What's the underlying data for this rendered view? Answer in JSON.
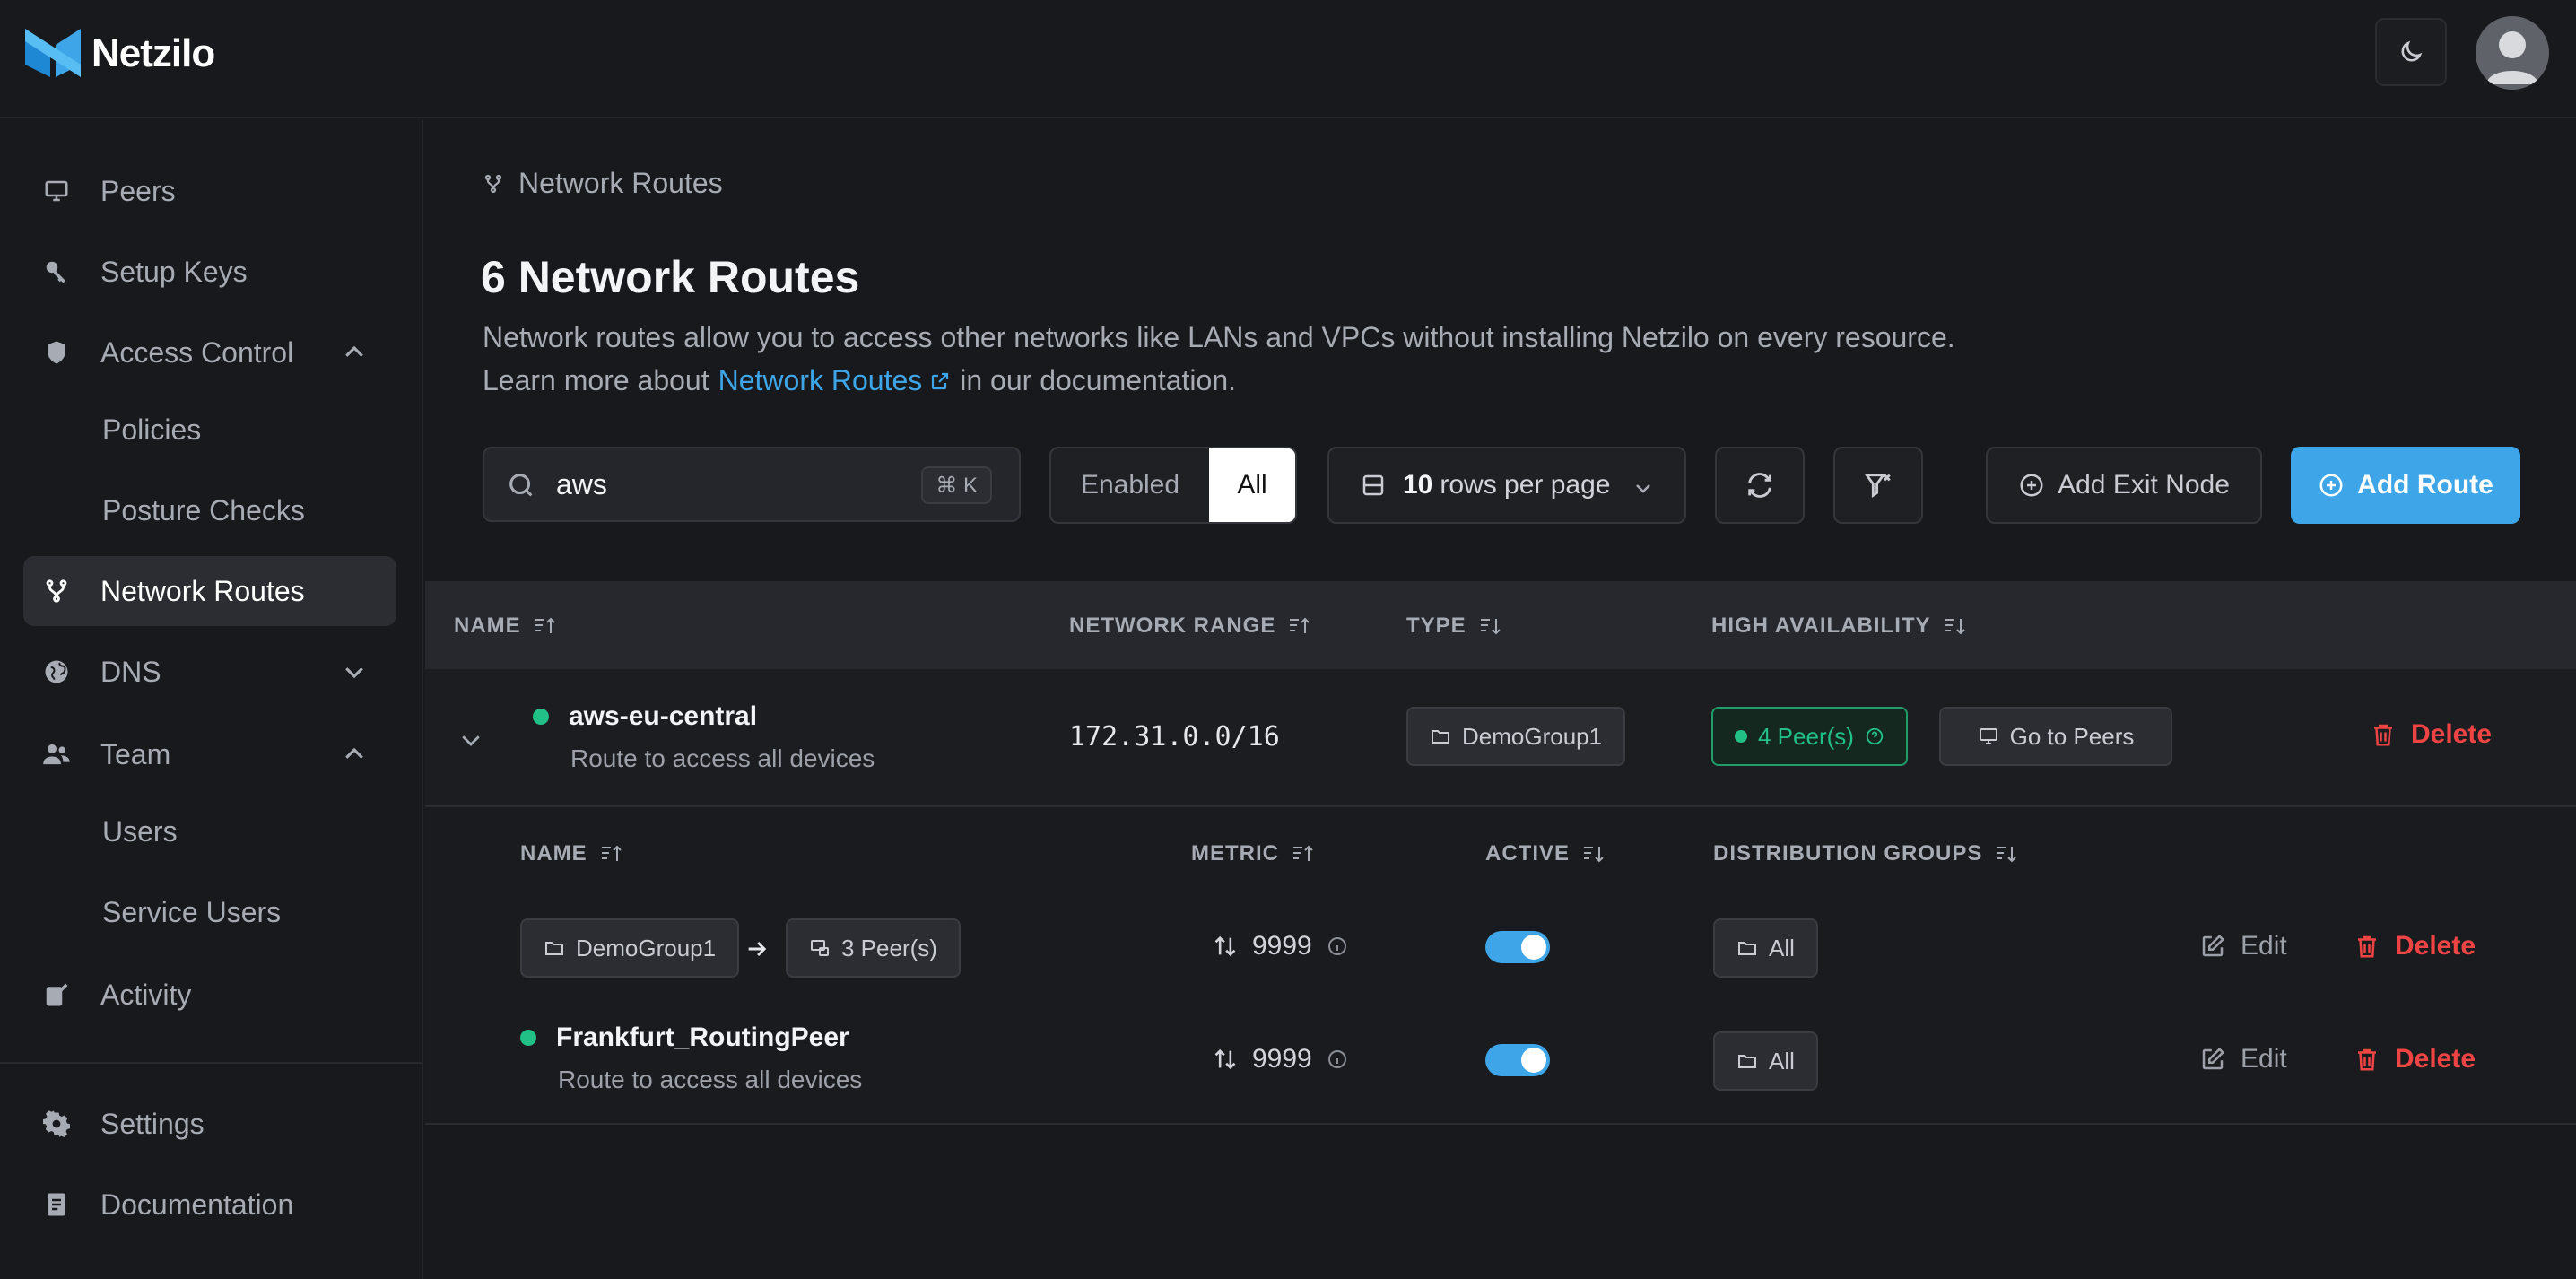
{
  "app": {
    "name": "Netzilo"
  },
  "sidebar": {
    "items": [
      {
        "label": "Peers",
        "icon": "monitor-icon"
      },
      {
        "label": "Setup Keys",
        "icon": "key-icon"
      },
      {
        "label": "Access Control",
        "icon": "shield-icon",
        "expanded": true
      },
      {
        "label": "Policies"
      },
      {
        "label": "Posture Checks"
      },
      {
        "label": "Network Routes",
        "icon": "route-icon",
        "active": true
      },
      {
        "label": "DNS",
        "icon": "globe-icon",
        "expanded": false
      },
      {
        "label": "Team",
        "icon": "users-icon",
        "expanded": true
      },
      {
        "label": "Users"
      },
      {
        "label": "Service Users"
      },
      {
        "label": "Activity",
        "icon": "activity-icon"
      },
      {
        "label": "Settings",
        "icon": "gear-icon"
      },
      {
        "label": "Documentation",
        "icon": "document-icon"
      }
    ]
  },
  "breadcrumb": {
    "label": "Network Routes"
  },
  "page": {
    "title": "6 Network Routes",
    "description": "Network routes allow you to access other networks like LANs and VPCs without installing Netzilo on every resource.",
    "learn_prefix": "Learn more about",
    "learn_link": "Network Routes",
    "learn_suffix": "in our documentation."
  },
  "toolbar": {
    "search_value": "aws",
    "search_shortcut": "⌘ K",
    "filter_enabled": "Enabled",
    "filter_all": "All",
    "rows_count": "10",
    "rows_label": "rows per page",
    "add_exit_node": "Add Exit Node",
    "add_route": "Add Route"
  },
  "table": {
    "headers": {
      "name": "NAME",
      "network_range": "NETWORK RANGE",
      "type": "TYPE",
      "high_availability": "HIGH AVAILABILITY"
    },
    "route": {
      "name": "aws-eu-central",
      "description": "Route to access all devices",
      "network_range": "172.31.0.0/16",
      "type_group": "DemoGroup1",
      "ha_peers": "4 Peer(s)",
      "go_to_peers": "Go to Peers",
      "delete": "Delete"
    },
    "sub_headers": {
      "name": "NAME",
      "metric": "METRIC",
      "active": "ACTIVE",
      "distribution_groups": "DISTRIBUTION GROUPS"
    },
    "sub_rows": [
      {
        "group": "DemoGroup1",
        "peers": "3 Peer(s)",
        "metric": "9999",
        "active": true,
        "distribution": "All",
        "edit": "Edit",
        "delete": "Delete"
      },
      {
        "name": "Frankfurt_RoutingPeer",
        "description": "Route to access all devices",
        "metric": "9999",
        "active": true,
        "distribution": "All",
        "edit": "Edit",
        "delete": "Delete"
      }
    ]
  },
  "colors": {
    "accent": "#3ea6e8",
    "success": "#22c087",
    "danger": "#ef4444",
    "background": "#18191c"
  }
}
